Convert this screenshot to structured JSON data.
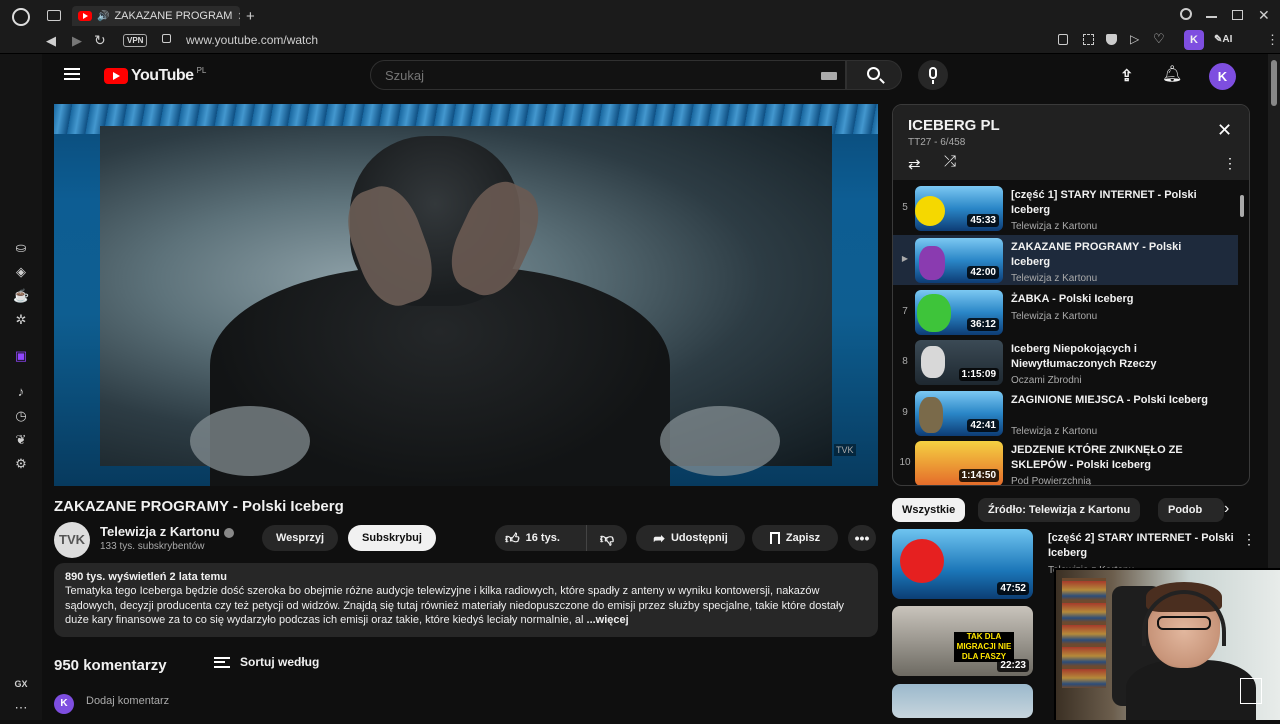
{
  "browser": {
    "tab_title": "ZAKAZANE PROGRAM",
    "url": "www.youtube.com/watch",
    "vpn_label": "VPN",
    "ai_label": "AI",
    "profile_letter": "K",
    "gx_label": "GX"
  },
  "masthead": {
    "logo_text": "YouTube",
    "logo_country": "PL",
    "search_placeholder": "Szukaj",
    "avatar_letter": "K"
  },
  "video": {
    "title": "ZAKAZANE PROGRAMY - Polski Iceberg",
    "watermark": "TVK",
    "channel": {
      "avatar_text": "TVK",
      "name": "Telewizja z Kartonu",
      "subscribers": "133 tys. subskrybentów"
    },
    "buttons": {
      "support": "Wesprzyj",
      "subscribe": "Subskrybuj",
      "likes": "16 tys.",
      "share": "Udostępnij",
      "save": "Zapisz"
    },
    "description": {
      "meta": "890 tys. wyświetleń  2 lata temu",
      "text": "Tematyka tego Iceberga będzie dość szeroka bo obejmie różne audycje telewizyjne i kilka radiowych, które spadły z anteny w wyniku kontowersji, nakazów sądowych, decyzji producenta czy też petycji od widzów. Znajdą się tutaj również materiały niedopuszczone do emisji przez służby specjalne, takie które dostały duże kary finansowe za to co się wydarzyło podczas ich emisji oraz takie, które kiedyś leciały normalnie, al",
      "more": "...więcej"
    }
  },
  "comments": {
    "count": "950 komentarzy",
    "sort_label": "Sortuj według",
    "add_placeholder": "Dodaj komentarz",
    "avatar_letter": "K"
  },
  "playlist": {
    "title": "ICEBERG PL",
    "subtitle": "TT27 - 6/458",
    "items": [
      {
        "index": "5",
        "title": "[część 1] STARY INTERNET - Polski Iceberg",
        "channel": "Telewizja z Kartonu",
        "duration": "45:33"
      },
      {
        "index": "▶",
        "title": "ZAKAZANE PROGRAMY - Polski Iceberg",
        "channel": "Telewizja z Kartonu",
        "duration": "42:00"
      },
      {
        "index": "7",
        "title": "ŻABKA - Polski Iceberg",
        "channel": "Telewizja z Kartonu",
        "duration": "36:12"
      },
      {
        "index": "8",
        "title": "Iceberg Niepokojących i Niewytłumaczonych Rzeczy",
        "channel": "Oczami Zbrodni",
        "duration": "1:15:09"
      },
      {
        "index": "9",
        "title": "ZAGINIONE MIEJSCA - Polski Iceberg",
        "channel": "Telewizja z Kartonu",
        "duration": "42:41"
      },
      {
        "index": "10",
        "title": "JEDZENIE KTÓRE ZNIKNĘŁO ZE SKLEPÓW - Polski Iceberg",
        "channel": "Pod Powierzchnią",
        "duration": "1:14:50"
      }
    ]
  },
  "chips": [
    "Wszystkie",
    "Źródło: Telewizja z Kartonu",
    "Podob"
  ],
  "recommendations": [
    {
      "title": "[część 2] STARY INTERNET - Polski Iceberg",
      "channel": "Telewizja z Kartonu",
      "duration": "47:52"
    },
    {
      "title": "",
      "channel": "",
      "duration": "22:23",
      "thumb_text": "TAK DLA MIGRACJI NIE DLA FASZY"
    },
    {
      "title": "",
      "channel": "",
      "duration": ""
    }
  ],
  "colors": {
    "brand_red": "#ff0000",
    "avatar_purple": "#7e4ee0",
    "active_row": "#1e2a3c"
  }
}
